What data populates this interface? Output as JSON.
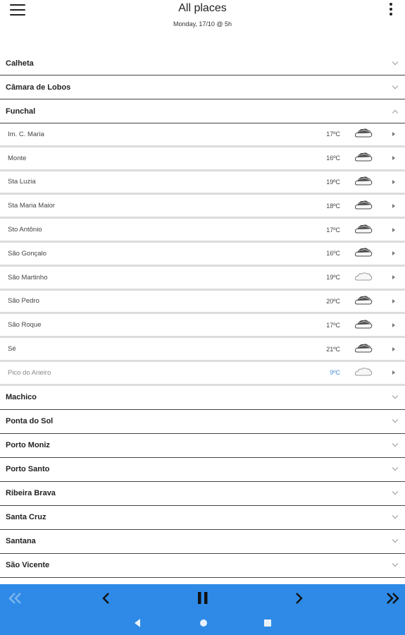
{
  "header": {
    "title": "All places",
    "subtitle": "Monday, 17/10 @ 5h"
  },
  "groups_top": [
    {
      "name": "Calheta"
    },
    {
      "name": "Câmara de Lobos"
    }
  ],
  "expanded_group": {
    "name": "Funchal",
    "places": [
      {
        "name": "Im. C. Maria",
        "temp": "17ºC",
        "icon": "cloud-partly"
      },
      {
        "name": "Monte",
        "temp": "16ºC",
        "icon": "cloud-partly"
      },
      {
        "name": "Sta Luzia",
        "temp": "19ºC",
        "icon": "cloud-partly"
      },
      {
        "name": "Sta Maria Maior",
        "temp": "18ºC",
        "icon": "cloud-partly"
      },
      {
        "name": "Sto Antônio",
        "temp": "17ºC",
        "icon": "cloud-partly"
      },
      {
        "name": "São Gonçalo",
        "temp": "16ºC",
        "icon": "cloud-partly"
      },
      {
        "name": "São Martinho",
        "temp": "19ºC",
        "icon": "cloud"
      },
      {
        "name": "São Pedro",
        "temp": "20ºC",
        "icon": "cloud-partly"
      },
      {
        "name": "São Roque",
        "temp": "17ºC",
        "icon": "cloud-partly"
      },
      {
        "name": "Sé",
        "temp": "21ºC",
        "icon": "cloud-partly"
      },
      {
        "name": "Pico do Arieiro",
        "temp": "9ºC",
        "icon": "cloud"
      }
    ]
  },
  "groups_bottom": [
    {
      "name": "Machico"
    },
    {
      "name": "Ponta do Sol"
    },
    {
      "name": "Porto Moniz"
    },
    {
      "name": "Porto Santo"
    },
    {
      "name": "Ribeira Brava"
    },
    {
      "name": "Santa Cruz"
    },
    {
      "name": "Santana"
    },
    {
      "name": "São Vicente"
    }
  ],
  "colors": {
    "bottom_bar": "#2e8ae6",
    "cold_temp": "#4a90d9",
    "disabled_nav": "#7fb6ef"
  },
  "icons": [
    "menu-icon",
    "more-vert-icon",
    "chevron-down-icon",
    "chevron-up-icon",
    "arrow-right-icon",
    "cloud-icon",
    "first-icon",
    "prev-icon",
    "pause-icon",
    "next-icon",
    "last-icon",
    "back-icon",
    "home-icon",
    "recents-icon"
  ]
}
